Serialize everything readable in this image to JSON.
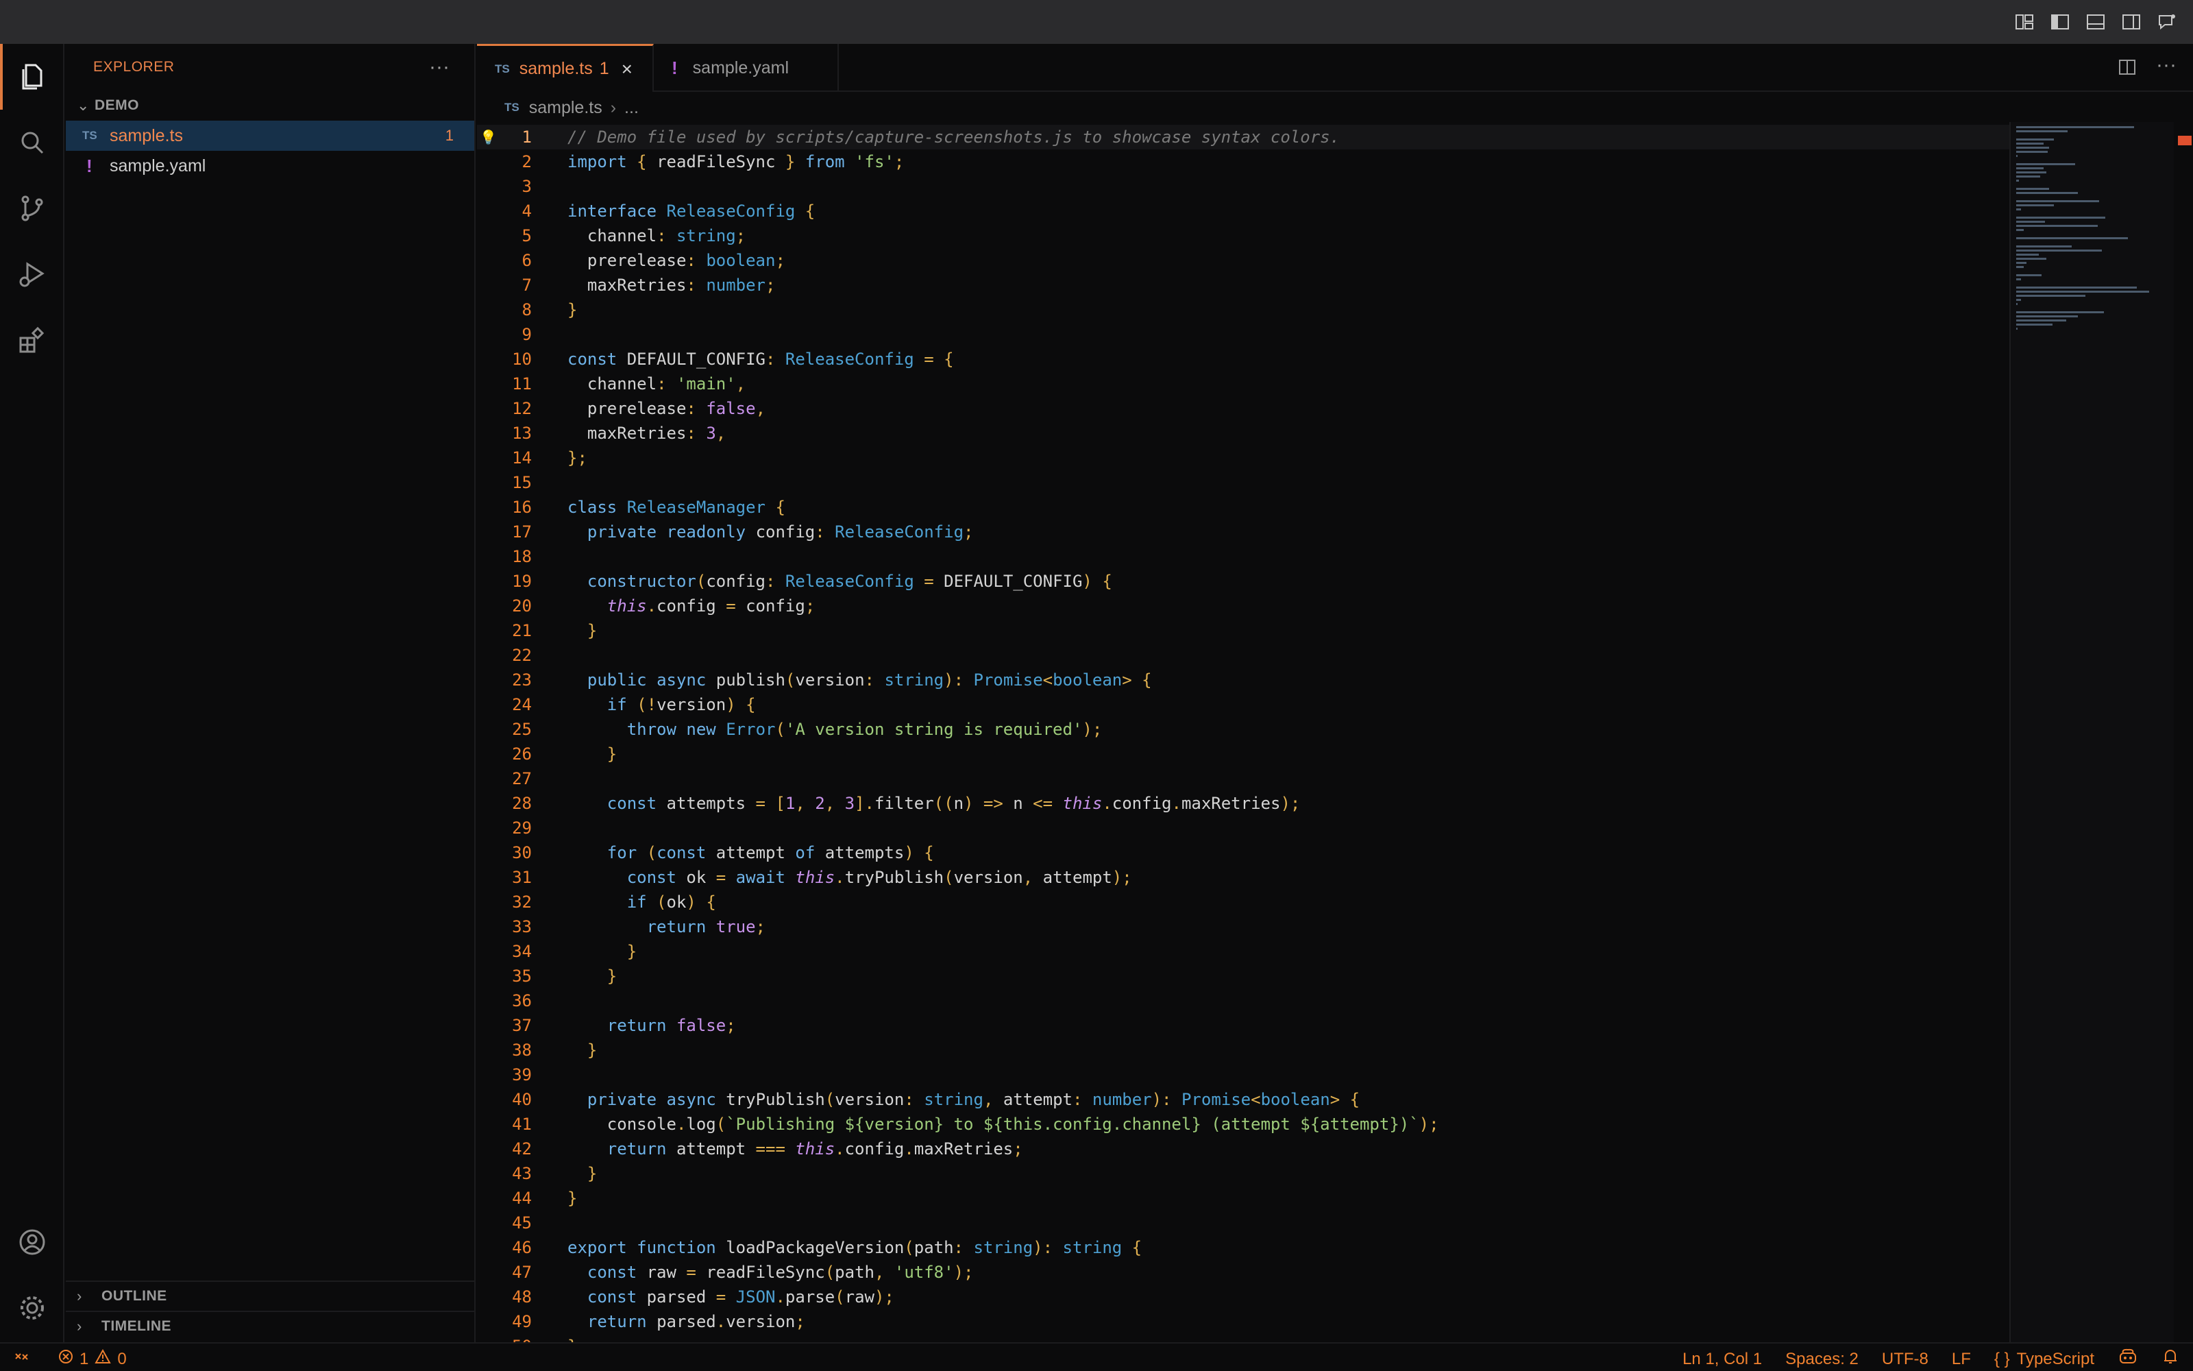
{
  "explorer": {
    "title": "EXPLORER",
    "more": "···",
    "folder": "DEMO",
    "files": [
      {
        "name": "sample.ts",
        "type_badge": "TS",
        "count": "1"
      },
      {
        "name": "sample.yaml",
        "type_badge": "!"
      }
    ],
    "outline": "OUTLINE",
    "timeline": "TIMELINE"
  },
  "tabs": [
    {
      "name": "sample.ts",
      "badge": "TS",
      "count": "1",
      "close": "×"
    },
    {
      "name": "sample.yaml",
      "badge": "!"
    }
  ],
  "tab_actions_more": "···",
  "breadcrumb": {
    "badge": "TS",
    "file": "sample.ts",
    "sep": "›",
    "rest": "..."
  },
  "code_lines": [
    "// Demo file used by scripts/capture-screenshots.js to showcase syntax colors.",
    "import { readFileSync } from 'fs';",
    "",
    "interface ReleaseConfig {",
    "  channel: string;",
    "  prerelease: boolean;",
    "  maxRetries: number;",
    "}",
    "",
    "const DEFAULT_CONFIG: ReleaseConfig = {",
    "  channel: 'main',",
    "  prerelease: false,",
    "  maxRetries: 3,",
    "};",
    "",
    "class ReleaseManager {",
    "  private readonly config: ReleaseConfig;",
    "",
    "  constructor(config: ReleaseConfig = DEFAULT_CONFIG) {",
    "    this.config = config;",
    "  }",
    "",
    "  public async publish(version: string): Promise<boolean> {",
    "    if (!version) {",
    "      throw new Error('A version string is required');",
    "    }",
    "",
    "    const attempts = [1, 2, 3].filter((n) => n <= this.config.maxRetries);",
    "",
    "    for (const attempt of attempts) {",
    "      const ok = await this.tryPublish(version, attempt);",
    "      if (ok) {",
    "        return true;",
    "      }",
    "    }",
    "",
    "    return false;",
    "  }",
    "",
    "  private async tryPublish(version: string, attempt: number): Promise<boolean> {",
    "    console.log(`Publishing ${version} to ${this.config.channel} (attempt ${attempt})`);",
    "    return attempt === this.config.maxRetries;",
    "  }",
    "}",
    "",
    "export function loadPackageVersion(path: string): string {",
    "  const raw = readFileSync(path, 'utf8');",
    "  const parsed = JSON.parse(raw);",
    "  return parsed.version;",
    "}"
  ],
  "status": {
    "errors": "1",
    "warnings": "0",
    "position": "Ln 1, Col 1",
    "spaces": "Spaces: 2",
    "encoding": "UTF-8",
    "eol": "LF",
    "language_icon": "{ }",
    "language": "TypeScript"
  },
  "colors": {
    "accent": "#e07a3e",
    "error": "#f2884f",
    "keyword": "#6fb3e8",
    "type": "#4ea1d3",
    "string": "#9ecb7a",
    "comment": "#7a7a7a",
    "constant": "#c792ea",
    "text": "#d4d4d4"
  },
  "icons": {
    "activity": [
      "files-icon",
      "search-icon",
      "source-control-icon",
      "run-debug-icon",
      "extensions-icon",
      "account-icon",
      "settings-gear-icon"
    ]
  }
}
